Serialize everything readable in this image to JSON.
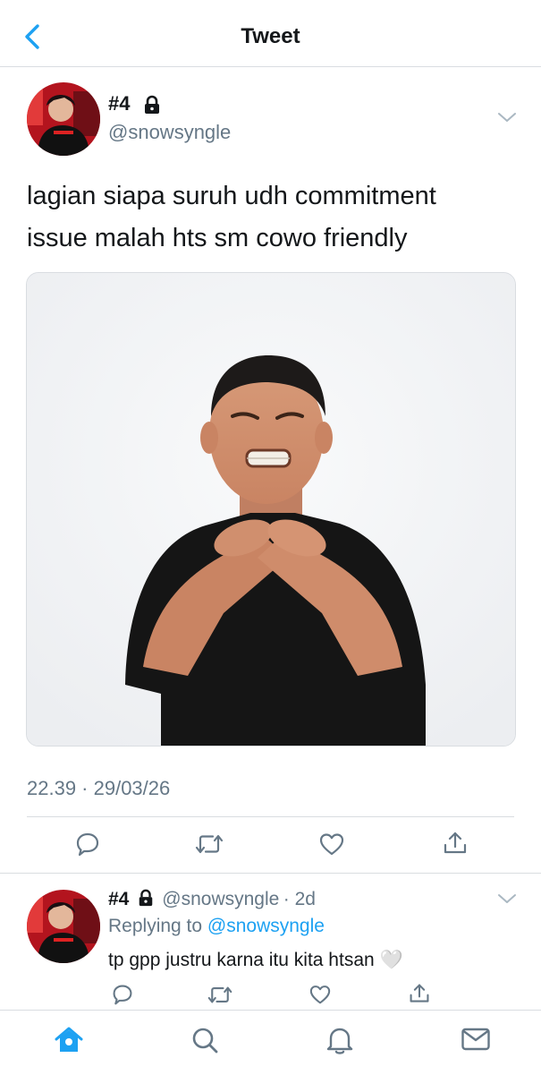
{
  "header": {
    "title": "Tweet",
    "back_icon": "chevron-left-icon"
  },
  "tweet": {
    "author": {
      "display_name": "#4",
      "handle": "@snowsyngle",
      "protected_icon": "lock-icon"
    },
    "text_line1": "lagian siapa suruh udh commitment",
    "text_line2": "issue malah hts sm cowo friendly",
    "timestamp": "22.39 · 29/03/26",
    "actions": [
      "reply-icon",
      "retweet-icon",
      "like-icon",
      "share-icon"
    ]
  },
  "reply": {
    "author": {
      "display_name": "#4",
      "handle": "@snowsyngle",
      "age": "· 2d"
    },
    "replying_label": "Replying to",
    "replying_handle": "@snowsyngle",
    "text": "tp gpp justru karna itu kita htsan",
    "emoji": "🤍"
  },
  "tabbar": {
    "items": [
      "home-icon",
      "search-icon",
      "notifications-icon",
      "messages-icon"
    ],
    "active": "home-icon"
  },
  "colors": {
    "accent": "#1da1f2",
    "secondary_text": "#657786",
    "primary_text": "#14171a",
    "divider": "#d9dde1"
  }
}
